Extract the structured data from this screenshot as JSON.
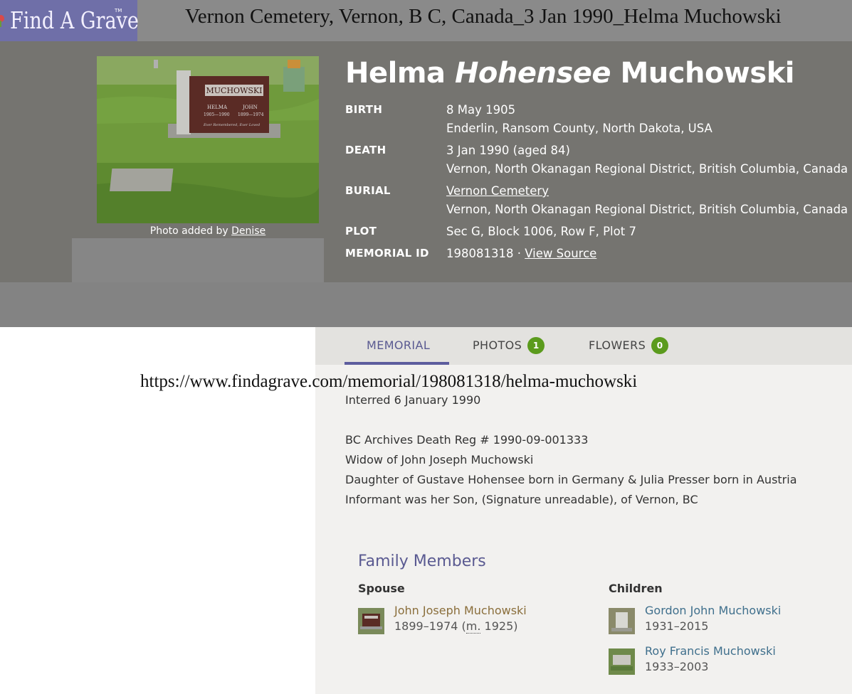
{
  "header": {
    "logo_text": "Find A Grave",
    "logo_tm": "TM",
    "document_title": "Vernon Cemetery, Vernon, B C, Canada_3 Jan 1990_Helma Muchowski"
  },
  "photo": {
    "headstone_name": "MUCHOWSKI",
    "headstone_left_name": "HELMA",
    "headstone_left_years": "1905—1990",
    "headstone_right_name": "JOHN",
    "headstone_right_years": "1899—1974",
    "headstone_motto": "Ever Remembered, Ever Loved",
    "caption_prefix": "Photo added by ",
    "caption_user": "Denise"
  },
  "memorial": {
    "first_name": "Helma",
    "maiden_name": "Hohensee",
    "last_name": "Muchowski",
    "facts": {
      "birth_label": "BIRTH",
      "birth_date": "8 May 1905",
      "birth_place": "Enderlin, Ransom County, North Dakota, USA",
      "death_label": "DEATH",
      "death_date": "3 Jan 1990 (aged 84)",
      "death_place": "Vernon, North Okanagan Regional District, British Columbia, Canada",
      "burial_label": "BURIAL",
      "burial_cemetery": "Vernon Cemetery",
      "burial_place": "Vernon, North Okanagan Regional District, British Columbia, Canada",
      "plot_label": "PLOT",
      "plot_value": "Sec G, Block 1006, Row F, Plot 7",
      "memorial_id_label": "MEMORIAL ID",
      "memorial_id": "198081318 · ",
      "view_source": "View Source"
    }
  },
  "url_overlay": "https://www.findagrave.com/memorial/198081318/helma-muchowski",
  "tabs": [
    {
      "label": "MEMORIAL",
      "active": true
    },
    {
      "label": "PHOTOS",
      "count": "1"
    },
    {
      "label": "FLOWERS",
      "count": "0"
    }
  ],
  "bio": {
    "line1": "Interred 6 January 1990",
    "line2": "BC Archives Death Reg # 1990-09-001333",
    "line3": "Widow of John Joseph Muchowski",
    "line4": "Daughter of Gustave Hohensee born in Germany & Julia Presser born in Austria",
    "line5": "Informant was her Son, (Signature unreadable), of Vernon, BC"
  },
  "family": {
    "title": "Family Members",
    "spouse_heading": "Spouse",
    "children_heading": "Children",
    "spouse": {
      "name": "John Joseph Muchowski",
      "years": "1899–1974 (",
      "marr_abbr": "m.",
      "marr_year": " 1925)"
    },
    "children": [
      {
        "name": "Gordon John Muchowski",
        "years": "1931–2015"
      },
      {
        "name": "Roy Francis Muchowski",
        "years": "1933–2003"
      }
    ]
  },
  "colors": {
    "accent_purple": "#5d5d9e",
    "badge_green": "#5b9b1d",
    "hero_bg": "#757470",
    "spouse_link": "#8a6e3b",
    "child_link": "#3f6f8c"
  }
}
